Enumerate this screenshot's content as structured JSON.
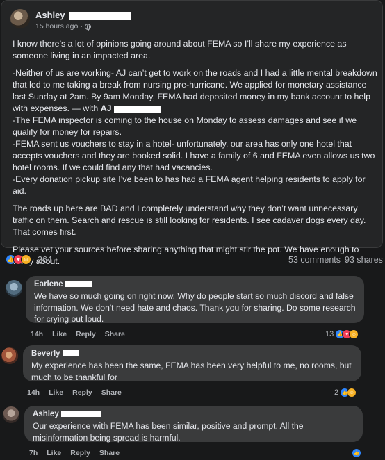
{
  "post": {
    "author": "Ashley",
    "time": "15 hours ago",
    "privacy_icon": "globe-icon",
    "paragraphs": [
      "I know there’s a lot of opinions going around about FEMA so I’ll share my experience as someone living in an impacted area.",
      "-Neither of us are working- AJ can’t get to work on the roads and I had a little mental breakdown that led to me taking a break from nursing pre-hurricane. We applied for monetary assistance last Sunday at 2am. By 9am Monday, FEMA had deposited money in my bank account to help with expenses.",
      "-The FEMA inspector is coming to the house on Monday to assess damages and see if we qualify for money for repairs.",
      "-FEMA sent us vouchers to stay in a hotel- unfortunately, our area has only one hotel that accepts vouchers and they are booked solid. I have a family of 6 and FEMA even allows us two hotel rooms. If we could find any that had vacancies.",
      "-Every donation pickup site I’ve been to has had a FEMA agent helping residents to apply for aid.",
      "The roads up here are BAD and I completely understand why they don’t want unnecessary traffic on them. Search and rescue is still looking for residents. I see cadaver dogs every day. That comes first.",
      "Please vet your sources before sharing anything that might stir the pot. We have enough to worry about."
    ],
    "tag_prefix": " — with ",
    "tag_name": "AJ",
    "reactions_count": "264",
    "comments_count": "53 comments",
    "shares_count": "93 shares"
  },
  "comments": [
    {
      "author": "Earlene",
      "text": "We have so much going on right now. Why do people start so much discord and false information. We don't need hate and chaos. Thank you for sharing. Do some research for crying out loud.",
      "time": "14h",
      "like": "Like",
      "reply": "Reply",
      "share": "Share",
      "reaction_count": "13"
    },
    {
      "author": "Beverly",
      "text": "My experience has been the same, FEMA has been very helpful to me, no rooms, but much to be thankful for",
      "time": "14h",
      "like": "Like",
      "reply": "Reply",
      "share": "Share",
      "reaction_count": "2"
    },
    {
      "author": "Ashley",
      "text": "Our experience with FEMA has been similar, positive and prompt. All the misinformation being spread is harmful.",
      "time": "7h",
      "like": "Like",
      "reply": "Reply",
      "share": "Share",
      "reaction_count": ""
    }
  ],
  "colors": {
    "background": "#18191a",
    "card": "#242526",
    "bubble": "#3a3b3c",
    "like_blue": "#2d86ff",
    "love_red": "#f33e58",
    "care_yellow": "#f7b125"
  }
}
